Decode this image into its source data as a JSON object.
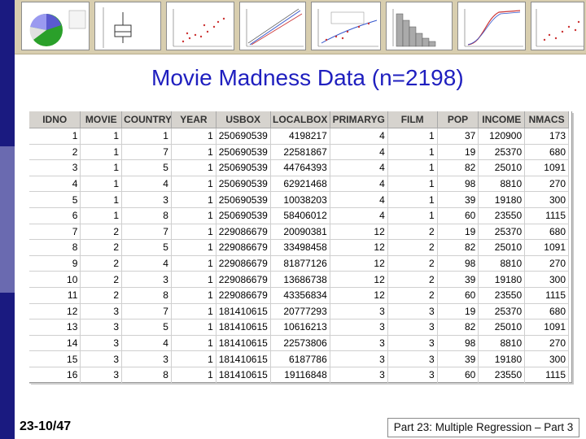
{
  "colors": {
    "title": "#1f1fbf",
    "banner": "#d8ceaf",
    "left_bar_dark": "#1a1a80",
    "left_bar_light": "#6a6ab0"
  },
  "title": "Movie Madness Data (n=2198)",
  "table": {
    "columns": [
      "IDNO",
      "MOVIE",
      "COUNTRY",
      "YEAR",
      "USBOX",
      "LOCALBOX",
      "PRIMARYG",
      "FILM",
      "POP",
      "INCOME",
      "NMACS"
    ],
    "rows": [
      [
        "1",
        "1",
        "1",
        "1",
        "250690539",
        "4198217",
        "4",
        "1",
        "37",
        "120900",
        "173"
      ],
      [
        "2",
        "1",
        "7",
        "1",
        "250690539",
        "22581867",
        "4",
        "1",
        "19",
        "25370",
        "680"
      ],
      [
        "3",
        "1",
        "5",
        "1",
        "250690539",
        "44764393",
        "4",
        "1",
        "82",
        "25010",
        "1091"
      ],
      [
        "4",
        "1",
        "4",
        "1",
        "250690539",
        "62921468",
        "4",
        "1",
        "98",
        "8810",
        "270"
      ],
      [
        "5",
        "1",
        "3",
        "1",
        "250690539",
        "10038203",
        "4",
        "1",
        "39",
        "19180",
        "300"
      ],
      [
        "6",
        "1",
        "8",
        "1",
        "250690539",
        "58406012",
        "4",
        "1",
        "60",
        "23550",
        "1115"
      ],
      [
        "7",
        "2",
        "7",
        "1",
        "229086679",
        "20090381",
        "12",
        "2",
        "19",
        "25370",
        "680"
      ],
      [
        "8",
        "2",
        "5",
        "1",
        "229086679",
        "33498458",
        "12",
        "2",
        "82",
        "25010",
        "1091"
      ],
      [
        "9",
        "2",
        "4",
        "1",
        "229086679",
        "81877126",
        "12",
        "2",
        "98",
        "8810",
        "270"
      ],
      [
        "10",
        "2",
        "3",
        "1",
        "229086679",
        "13686738",
        "12",
        "2",
        "39",
        "19180",
        "300"
      ],
      [
        "11",
        "2",
        "8",
        "1",
        "229086679",
        "43356834",
        "12",
        "2",
        "60",
        "23550",
        "1115"
      ],
      [
        "12",
        "3",
        "7",
        "1",
        "181410615",
        "20777293",
        "3",
        "3",
        "19",
        "25370",
        "680"
      ],
      [
        "13",
        "3",
        "5",
        "1",
        "181410615",
        "10616213",
        "3",
        "3",
        "82",
        "25010",
        "1091"
      ],
      [
        "14",
        "3",
        "4",
        "1",
        "181410615",
        "22573806",
        "3",
        "3",
        "98",
        "8810",
        "270"
      ],
      [
        "15",
        "3",
        "3",
        "1",
        "181410615",
        "6187786",
        "3",
        "3",
        "39",
        "19180",
        "300"
      ],
      [
        "16",
        "3",
        "8",
        "1",
        "181410615",
        "19116848",
        "3",
        "3",
        "60",
        "23550",
        "1115"
      ]
    ]
  },
  "footer": {
    "slide_number": "23-10/47",
    "section": "Part 23: Multiple Regression – Part 3"
  }
}
